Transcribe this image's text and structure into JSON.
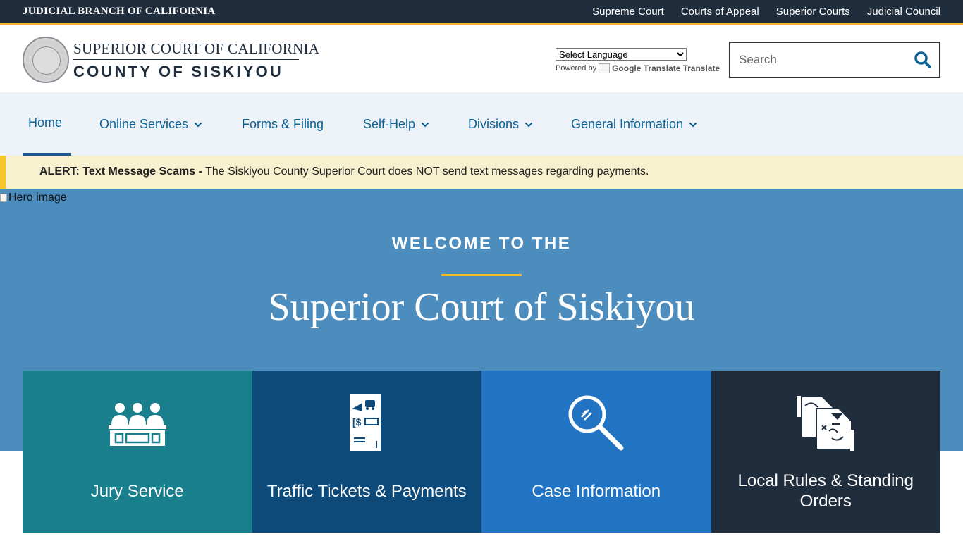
{
  "topbar": {
    "brand": "JUDICIAL BRANCH OF CALIFORNIA",
    "links": [
      "Supreme Court",
      "Courts of Appeal",
      "Superior Courts",
      "Judicial Council"
    ]
  },
  "header": {
    "seal_text": "JUDICIAL BRANCH OF CALIFORNIA",
    "court_line1": "SUPERIOR COURT OF CALIFORNIA",
    "court_line2": "COUNTY OF SISKIYOU",
    "language_select": "Select Language",
    "powered_by": "Powered by",
    "translate_img_alt": "Google Translate",
    "translate_label": "Translate",
    "search_placeholder": "Search"
  },
  "nav": {
    "items": [
      {
        "label": "Home",
        "active": true
      },
      {
        "label": "Online Services"
      },
      {
        "label": "Forms & Filing"
      },
      {
        "label": "Self-Help"
      },
      {
        "label": "Divisions"
      },
      {
        "label": "General Information"
      }
    ]
  },
  "alert": {
    "prefix": "ALERT: Text Message Scams -",
    "message": "The Siskiyou County Superior Court does NOT send text messages regarding payments."
  },
  "hero": {
    "image_alt": "Hero image",
    "welcome": "WELCOME TO THE",
    "title": "Superior Court of Siskiyou"
  },
  "cards": [
    {
      "label": "Jury Service",
      "icon": "jury-icon"
    },
    {
      "label": "Traffic Tickets & Payments",
      "icon": "ticket-icon"
    },
    {
      "label": "Case Information",
      "icon": "magnifier-icon"
    },
    {
      "label": "Local Rules & Standing Orders",
      "icon": "documents-icon"
    }
  ],
  "colors": {
    "topbar": "#1f2d3d",
    "gold": "#f2b830",
    "nav_bg": "#edf2f8",
    "nav_text": "#0d6293",
    "alert_bg": "#f8f1cf",
    "hero": "#4d8dbd",
    "card_teal": "#1a7f8c",
    "card_navy": "#0d4a7a",
    "card_blue": "#2373c3",
    "card_dark": "#1f2d3d"
  }
}
